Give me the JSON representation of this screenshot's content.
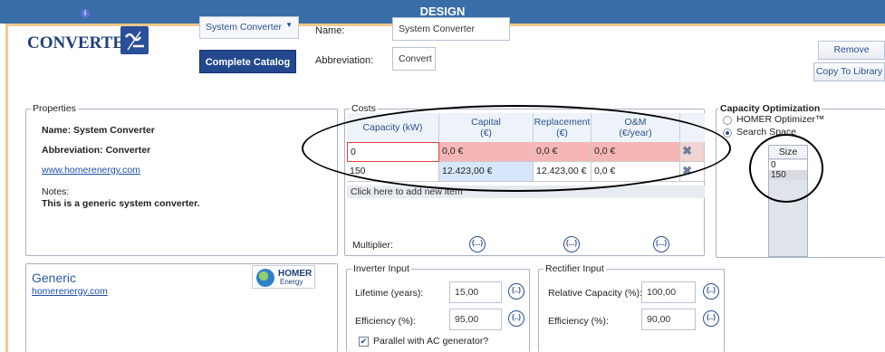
{
  "window": {
    "title": "DESIGN"
  },
  "header": {
    "component_title": "CONVERTER",
    "info_icon": "info-icon",
    "type_select": "System Converter",
    "complete_catalog": "Complete Catalog",
    "name_label": "Name:",
    "name_value": "System Converter",
    "abbr_label": "Abbreviation:",
    "abbr_value": "Convert",
    "remove": "Remove",
    "copy_to_library": "Copy To Library"
  },
  "properties": {
    "legend": "Properties",
    "name_line": "Name: System Converter",
    "abbr_line": "Abbreviation: Converter",
    "website": "www.homerenergy.com",
    "notes_label": "Notes:",
    "notes_text": "This is a generic system converter."
  },
  "costs": {
    "legend": "Costs",
    "headers": [
      "Capacity (kW)",
      "Capital\n(€)",
      "Replacement\n(€)",
      "O&M\n(€/year)"
    ],
    "rows": [
      {
        "capacity": "0",
        "capital": "0,0 €",
        "replacement": "0,0 €",
        "om": "0,0 €",
        "error": true
      },
      {
        "capacity": "150",
        "capital": "12.423,00 €",
        "replacement": "12.423,00 €",
        "om": "0,0 €",
        "error": false
      }
    ],
    "add_item": "Click here to add new item",
    "multiplier_label": "Multiplier:",
    "multiplier_button": "(...)"
  },
  "capacity_optimization": {
    "legend": "Capacity Optimization",
    "option_optimizer": "HOMER Optimizer™",
    "option_search": "Search Space",
    "selected": "Search Space",
    "size_header": "Size (kW)",
    "sizes": [
      "0",
      "150"
    ]
  },
  "manufacturer": {
    "name": "Generic",
    "website": "homerenergy.com",
    "logo_text_1": "HOMER",
    "logo_text_2": "Energy"
  },
  "inverter": {
    "legend": "Inverter Input",
    "lifetime_label": "Lifetime (years):",
    "lifetime_value": "15,00",
    "efficiency_label": "Efficiency (%):",
    "efficiency_value": "95,00",
    "parallel_label": "Parallel with AC generator?",
    "parallel_checked": true
  },
  "rectifier": {
    "legend": "Rectifier Input",
    "relcap_label": "Relative Capacity (%):",
    "relcap_value": "100,00",
    "efficiency_label": "Efficiency (%):",
    "efficiency_value": "90,00"
  },
  "colors": {
    "title_bar": "#3a6ea8",
    "frame": "#f3c98b",
    "accent": "#24488e",
    "error_cell": "#f7b6b6"
  }
}
